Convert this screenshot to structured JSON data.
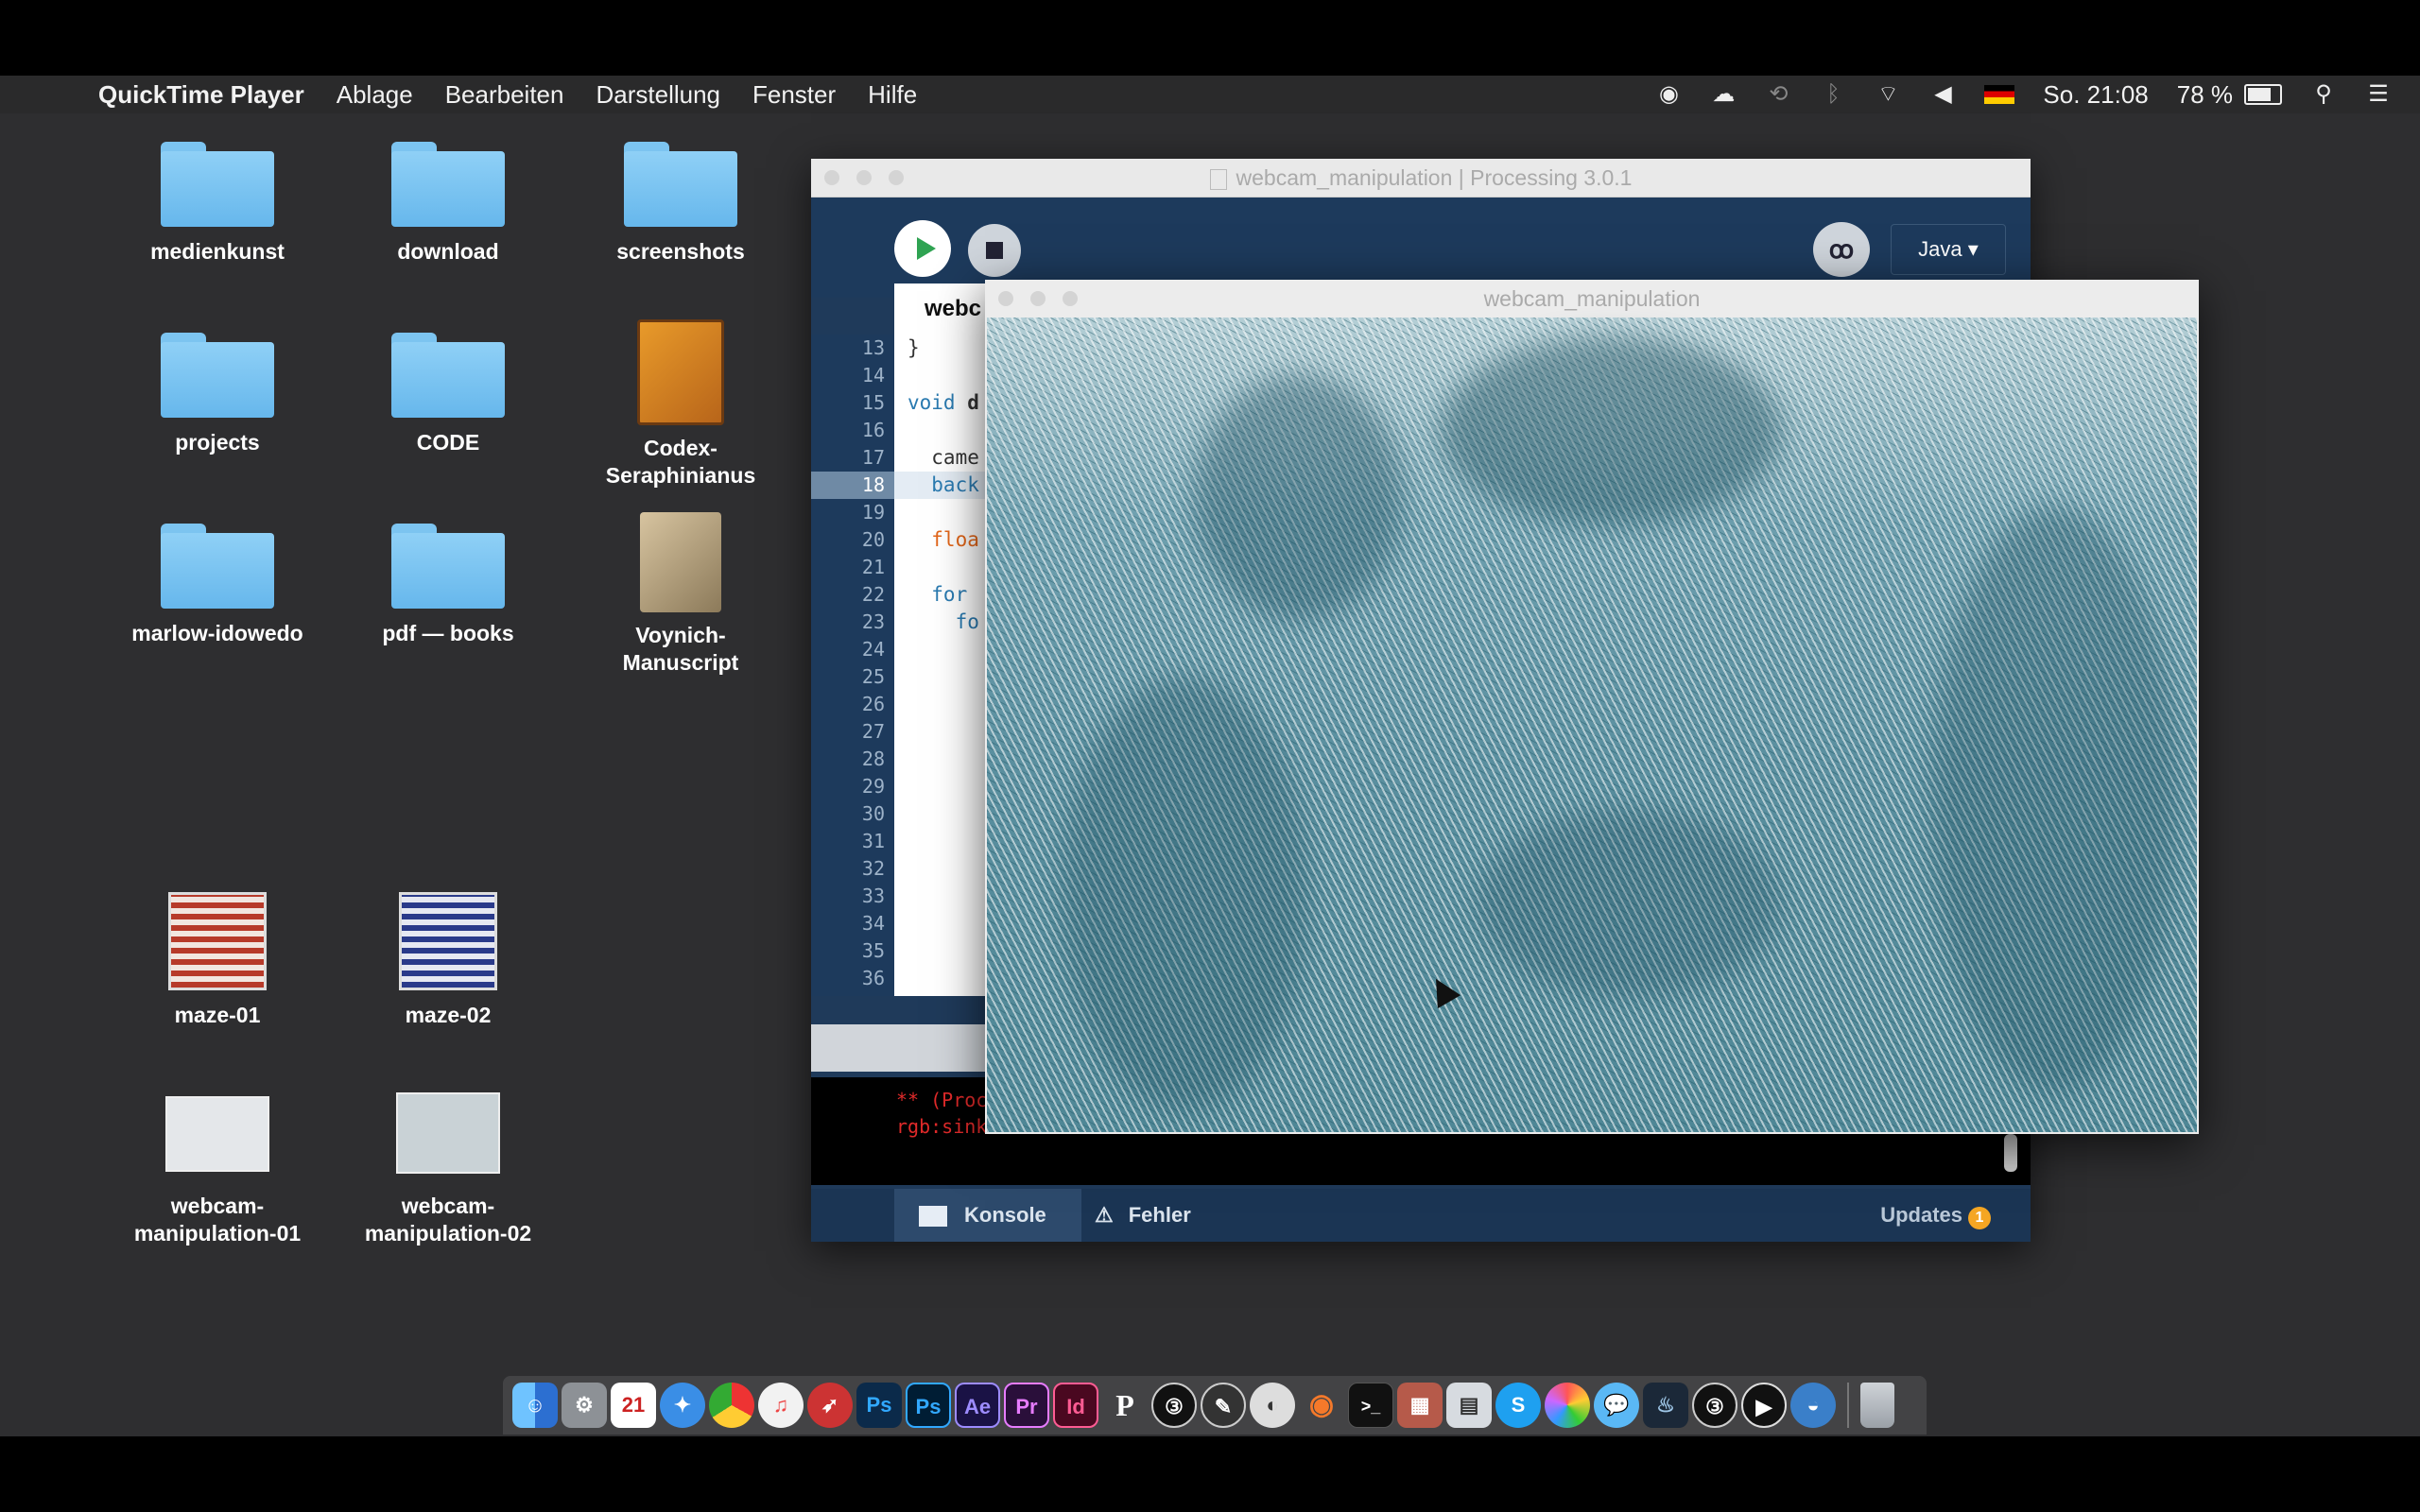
{
  "menubar": {
    "app": "QuickTime Player",
    "menus": [
      "Ablage",
      "Bearbeiten",
      "Darstellung",
      "Fenster",
      "Hilfe"
    ],
    "clock": "So. 21:08",
    "battery": "78 %"
  },
  "desktop": {
    "items": [
      {
        "label": "medienkunst"
      },
      {
        "label": "download"
      },
      {
        "label": "screenshots"
      },
      {
        "label": "projects"
      },
      {
        "label": "CODE"
      },
      {
        "label": "Codex-\nSeraphinianus"
      },
      {
        "label": "marlow-idowedo"
      },
      {
        "label": "pdf — books"
      },
      {
        "label": "Voynich-\nManuscript"
      },
      {
        "label": "maze-01"
      },
      {
        "label": "maze-02"
      },
      {
        "label": "webcam-\nmanipulation-01"
      },
      {
        "label": "webcam-\nmanipulation-02"
      }
    ]
  },
  "processing": {
    "title": "webcam_manipulation | Processing 3.0.1",
    "mode": "Java ▾",
    "tab": "webc",
    "line_numbers": [
      "13",
      "14",
      "15",
      "16",
      "17",
      "18",
      "19",
      "20",
      "21",
      "22",
      "23",
      "24",
      "25",
      "26",
      "27",
      "28",
      "29",
      "30",
      "31",
      "32",
      "33",
      "34",
      "35",
      "36"
    ],
    "code": {
      "l13": "}",
      "l15a": "void ",
      "l15b": "d",
      "l17": "  came",
      "l18": "  back",
      "l20": "  floa",
      "l22": "  for ",
      "l23": "    fo"
    },
    "console": {
      "line1": "** (Proc",
      "line2": "rgb:sink"
    },
    "bottom": {
      "console_tab": "Konsole",
      "errors_tab": "Fehler",
      "updates": "Updates",
      "updates_count": "1"
    }
  },
  "sketch": {
    "title": "webcam_manipulation"
  },
  "dock": {
    "apps": [
      "Finder",
      "System Preferences",
      "Calendar",
      "Safari",
      "Chrome",
      "iTunes",
      "Launchpad",
      "Ps",
      "Ps",
      "Ae",
      "Pr",
      "Id",
      "P",
      "Processing",
      "Inkscape",
      "Kernel",
      "Blender",
      "Terminal",
      "Preview",
      "Files",
      "Skype",
      "Photos",
      "Messages",
      "Steam",
      "Processing",
      "QuickTime",
      "Network",
      "Trash"
    ],
    "calendar_day": "21"
  }
}
